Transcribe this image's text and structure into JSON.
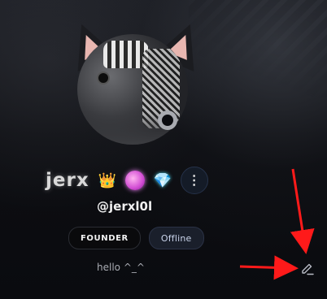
{
  "profile": {
    "display_name": "jerx",
    "handle": "@jerxl0l",
    "badges": [
      "crown",
      "pink-gem",
      "diamond"
    ],
    "more_label": "⋮",
    "tags": {
      "founder": "FOUNDER",
      "status": "Offline"
    },
    "bio": "hello ^_^",
    "status_color": "#a8aab0"
  },
  "annotations": {
    "arrow_color": "#ff1a1a"
  },
  "icons": {
    "crown": "crown-icon",
    "pink_gem": "pink-gem-icon",
    "diamond": "diamond-icon",
    "edit": "pencil-icon"
  }
}
